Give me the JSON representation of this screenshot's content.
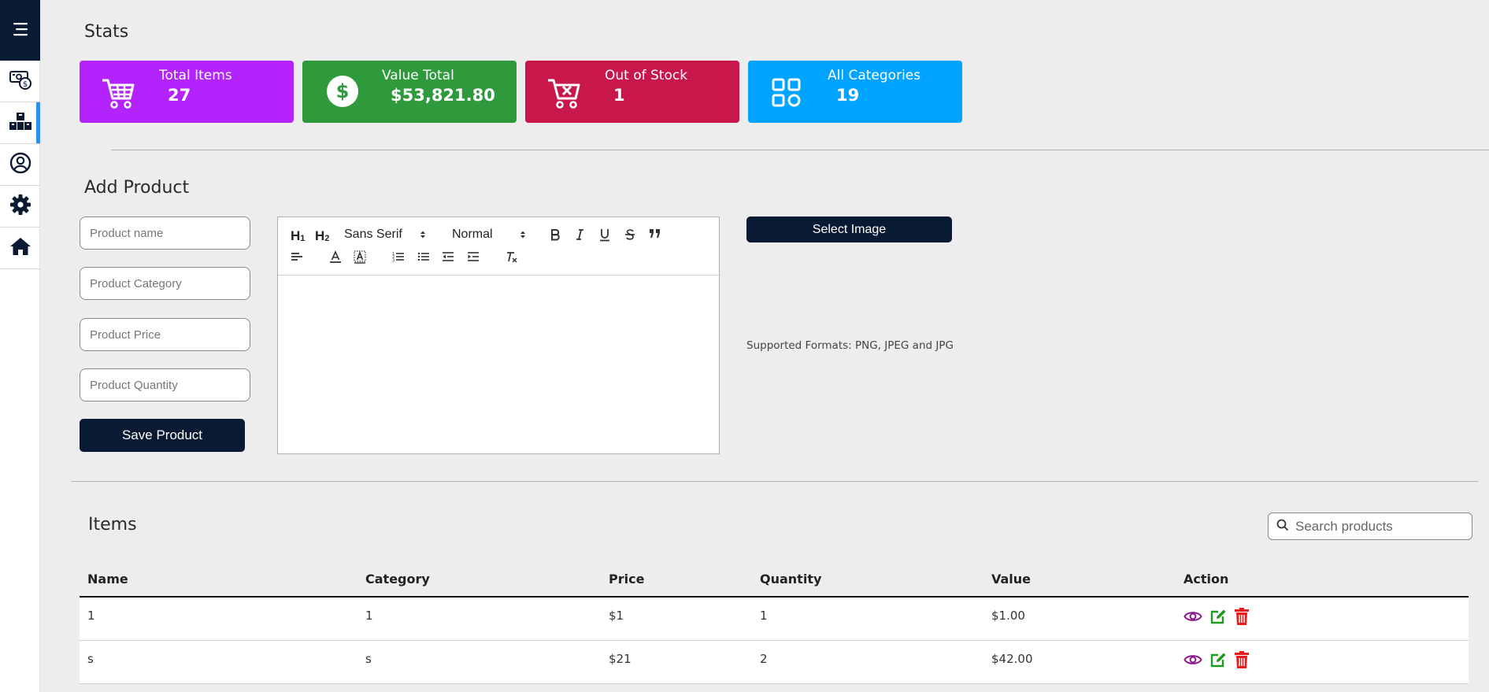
{
  "colors": {
    "sidebar_dark": "#0b1a33",
    "active_indicator": "#2b8ef0",
    "card_purple": "#b324fc",
    "card_green": "#2e9a3c",
    "card_red": "#c8174a",
    "card_blue": "#00a3ff",
    "view_icon": "#8b1a8b",
    "edit_icon": "#1e9a1e",
    "delete_icon": "#e81c1c"
  },
  "sidebar": {
    "menu_icon": "hamburger-icon",
    "items": [
      {
        "icon": "money-icon",
        "active": false
      },
      {
        "icon": "inventory-icon",
        "active": true
      },
      {
        "icon": "user-circle-icon",
        "active": false
      },
      {
        "icon": "gear-icon",
        "active": false
      },
      {
        "icon": "home-icon",
        "active": false
      }
    ]
  },
  "stats": {
    "title": "Stats",
    "cards": [
      {
        "label": "Total Items",
        "value": "27",
        "icon": "cart-icon"
      },
      {
        "label": "Value Total",
        "value": "$53,821.80",
        "icon": "dollar-icon"
      },
      {
        "label": "Out of Stock",
        "value": "1",
        "icon": "cart-remove-icon"
      },
      {
        "label": "All Categories",
        "value": "19",
        "icon": "categories-icon"
      }
    ]
  },
  "add_product": {
    "title": "Add Product",
    "fields": {
      "name_placeholder": "Product name",
      "category_placeholder": "Product Category",
      "price_placeholder": "Product Price",
      "quantity_placeholder": "Product Quantity"
    },
    "save_label": "Save Product",
    "editor": {
      "font_value": "Sans Serif",
      "size_value": "Normal",
      "h1_label": "H",
      "h2_label": "H",
      "h1_sub": "1",
      "h2_sub": "2"
    },
    "select_image_label": "Select Image",
    "supported_formats": "Supported Formats: PNG, JPEG and JPG"
  },
  "items": {
    "title": "Items",
    "search_placeholder": "Search products",
    "columns": [
      "Name",
      "Category",
      "Price",
      "Quantity",
      "Value",
      "Action"
    ],
    "rows": [
      {
        "name": "1",
        "category": "1",
        "price": "$1",
        "quantity": "1",
        "value": "$1.00"
      },
      {
        "name": "s",
        "category": "s",
        "price": "$21",
        "quantity": "2",
        "value": "$42.00"
      }
    ]
  }
}
